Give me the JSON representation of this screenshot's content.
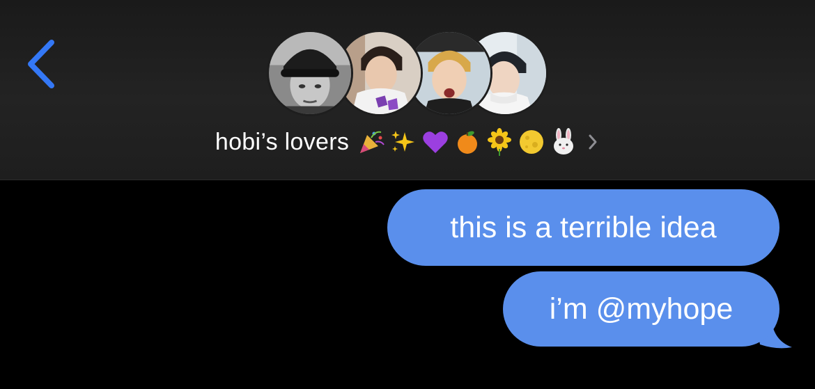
{
  "header": {
    "back_icon": "chevron-left-icon",
    "group_name": "hobi’s lovers",
    "emoji_icons": [
      "party-popper-icon",
      "sparkles-icon",
      "purple-heart-icon",
      "tangerine-icon",
      "sunflower-icon",
      "full-moon-icon",
      "rabbit-face-icon"
    ],
    "chevron_icon": "chevron-right-icon",
    "avatars": [
      "avatar-1",
      "avatar-2",
      "avatar-3",
      "avatar-4"
    ]
  },
  "messages": [
    {
      "text": "this is a terrible idea",
      "sender": "me"
    },
    {
      "text": "i’m @myhope",
      "sender": "me"
    }
  ],
  "colors": {
    "accent": "#3478f6",
    "bubble": "#5a8fec",
    "header_bg": "#202020",
    "background": "#000000"
  }
}
